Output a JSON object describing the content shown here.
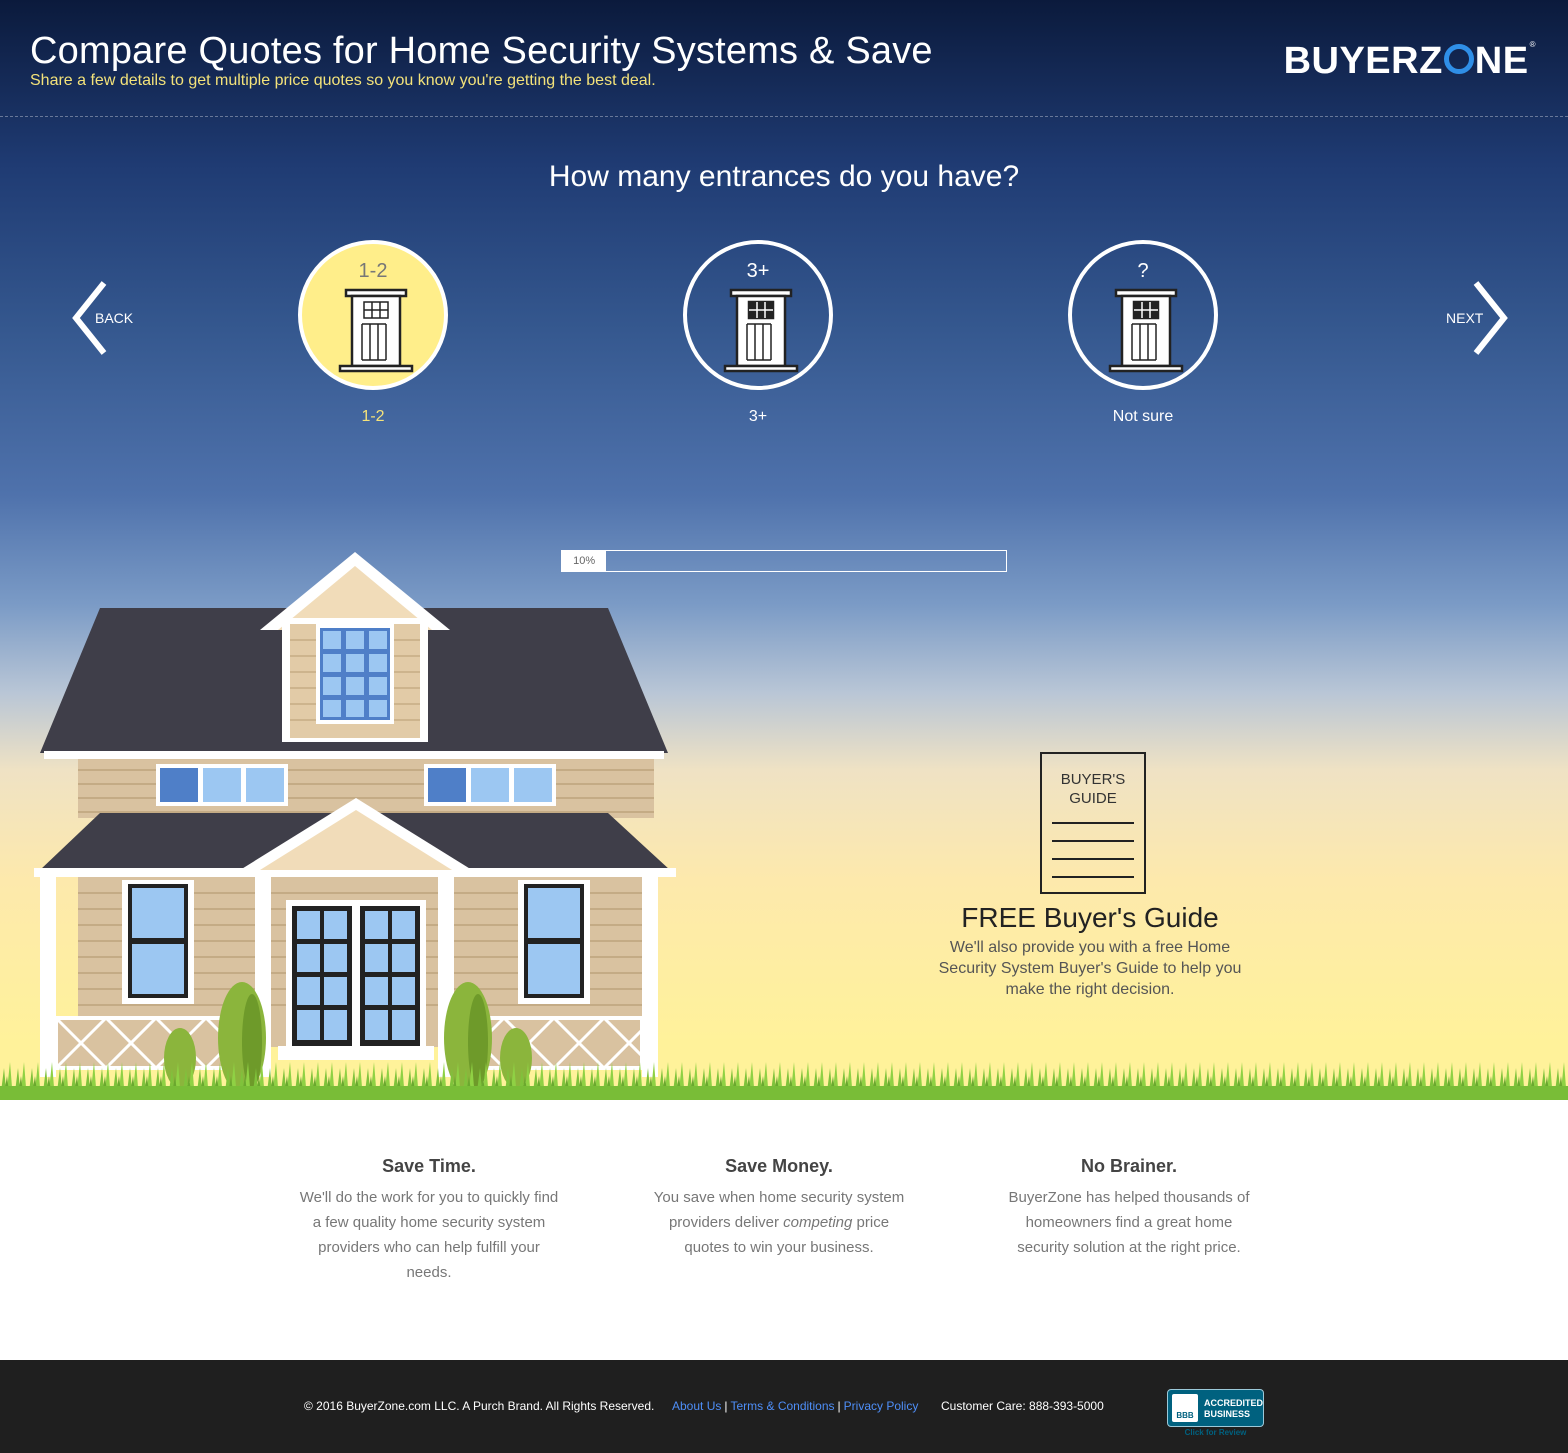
{
  "header": {
    "title": "Compare Quotes for Home Security Systems & Save",
    "subtitle": "Share a few details to get multiple price quotes so you know you're getting the best deal.",
    "logo_pre": "BUYERZ",
    "logo_post": "NE",
    "logo_mark": "®"
  },
  "question": "How many entrances do you have?",
  "nav": {
    "back_label": "BACK",
    "next_label": "NEXT"
  },
  "options": [
    {
      "badge": "1-2",
      "label": "1-2",
      "selected": true
    },
    {
      "badge": "3+",
      "label": "3+",
      "selected": false
    },
    {
      "badge": "?",
      "label": "Not sure",
      "selected": false
    }
  ],
  "progress": {
    "label": "10%",
    "value": 0.1
  },
  "guide": {
    "book_line1": "BUYER'S",
    "book_line2": "GUIDE",
    "title": "FREE Buyer's Guide",
    "text": "We'll also provide you with a free Home Security System Buyer's Guide to help you make the right decision."
  },
  "benefits": [
    {
      "title": "Save Time.",
      "text": "We'll do the work for you to quickly find a few quality home security system providers who can help fulfill your needs."
    },
    {
      "title": "Save Money.",
      "text_pre": "You save when home security system providers deliver ",
      "text_em": "competing",
      "text_post": " price quotes to win your business."
    },
    {
      "title": "No Brainer.",
      "text": "BuyerZone has helped thousands of homeowners find a great home security solution at the right price."
    }
  ],
  "footer": {
    "copyright": "© 2016 BuyerZone.com LLC. A Purch Brand. All Rights Reserved.",
    "links": [
      "About Us",
      "Terms & Conditions",
      "Privacy Policy"
    ],
    "customer_care": "Customer Care: 888-393-5000",
    "bbb_line1": "ACCREDITED",
    "bbb_line2": "BUSINESS",
    "bbb_logo": "BBB",
    "bbb_review": "Click for Review"
  },
  "colors": {
    "accent_yellow": "#f6e37a",
    "selected_fill": "#ffee8a",
    "link_blue": "#4e8ef7",
    "logo_blue": "#2f8fe7"
  },
  "icons": [
    "chevron-left-icon",
    "chevron-right-icon",
    "door-icon",
    "book-icon",
    "bbb-icon"
  ]
}
